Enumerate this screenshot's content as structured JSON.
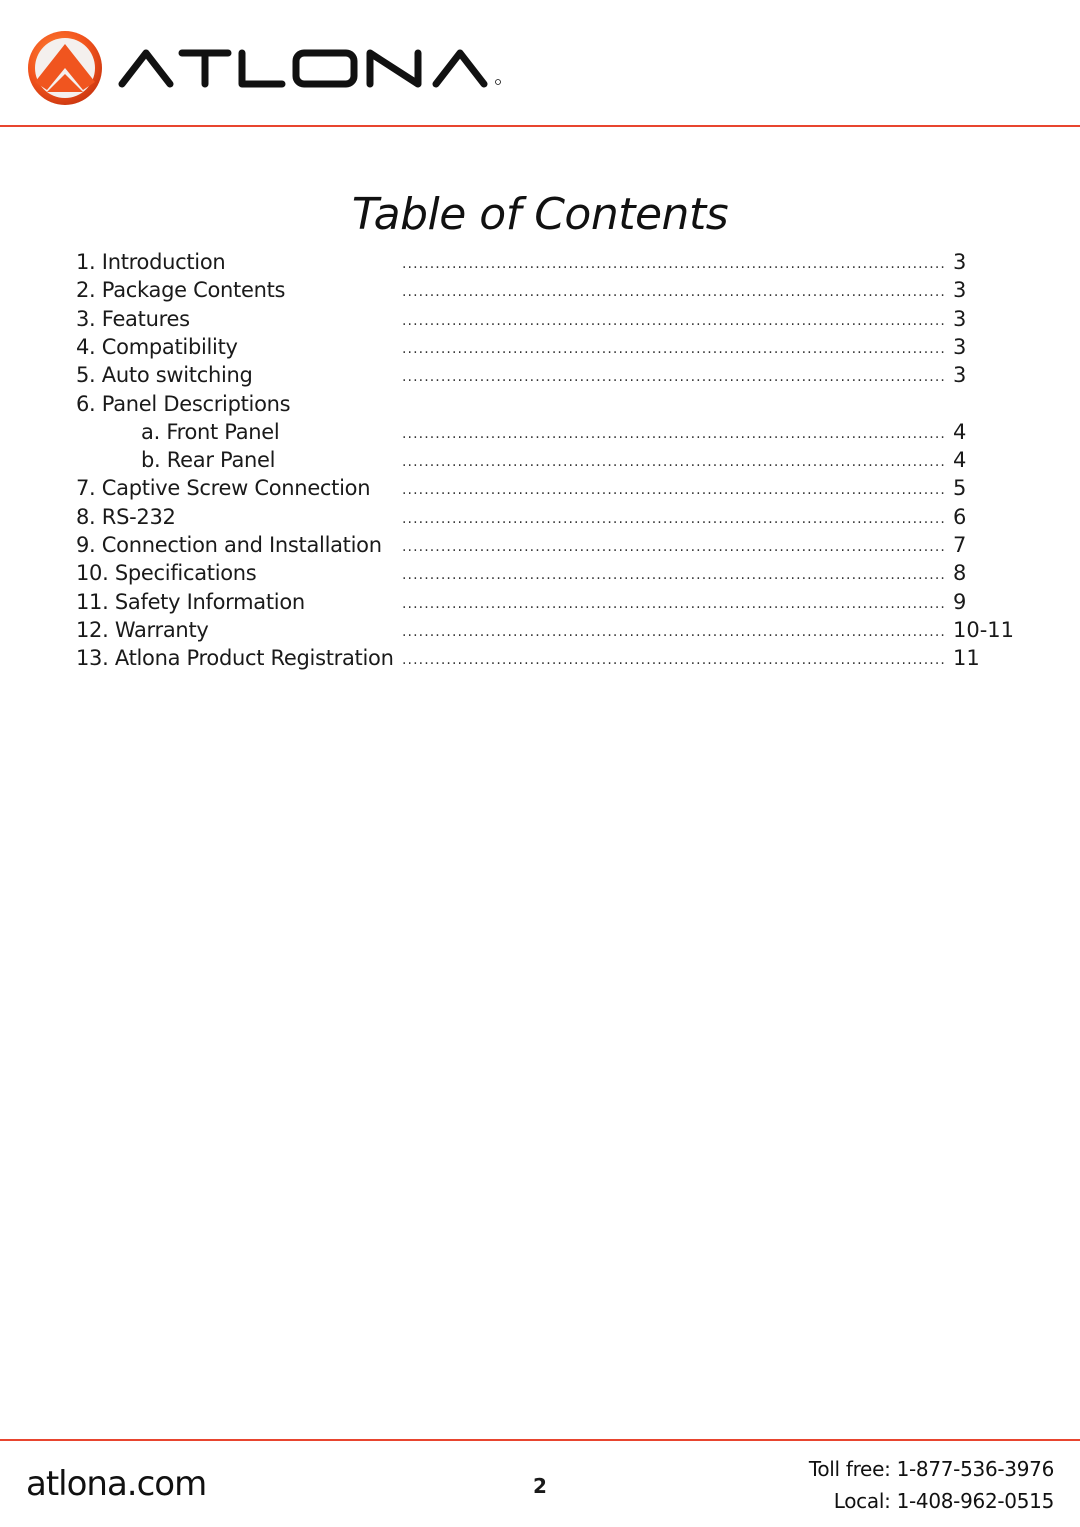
{
  "header": {
    "logo_text": "ATLONA",
    "logo_mark": "atlona-circle-logo",
    "brand_color": "#e8452f"
  },
  "title": "Table of Contents",
  "toc": {
    "entries": [
      {
        "label": "1. Introduction",
        "page": "3",
        "indent": false
      },
      {
        "label": "2. Package Contents",
        "page": "3",
        "indent": false
      },
      {
        "label": "3. Features",
        "page": "3",
        "indent": false
      },
      {
        "label": "4. Compatibility",
        "page": "3",
        "indent": false
      },
      {
        "label": "5. Auto switching",
        "page": "3",
        "indent": false
      },
      {
        "label": "6. Panel Descriptions",
        "page": "",
        "indent": false
      },
      {
        "label": "a. Front Panel",
        "page": "4",
        "indent": true
      },
      {
        "label": "b. Rear Panel",
        "page": "4",
        "indent": true
      },
      {
        "label": "7. Captive Screw Connection",
        "page": "5",
        "indent": false
      },
      {
        "label": "8. RS-232",
        "page": "6",
        "indent": false
      },
      {
        "label": "9. Connection and Installation",
        "page": "7",
        "indent": false
      },
      {
        "label": "10. Specifications",
        "page": "8",
        "indent": false
      },
      {
        "label": "11. Safety Information",
        "page": "9",
        "indent": false
      },
      {
        "label": "12. Warranty",
        "page": "10-11",
        "indent": false
      },
      {
        "label": "13. Atlona Product Registration",
        "page": "11",
        "indent": false
      }
    ]
  },
  "footer": {
    "website": "atlona.com",
    "page_number": "2",
    "toll_free": "Toll free: 1-877-536-3976",
    "local": "Local: 1-408-962-0515"
  }
}
